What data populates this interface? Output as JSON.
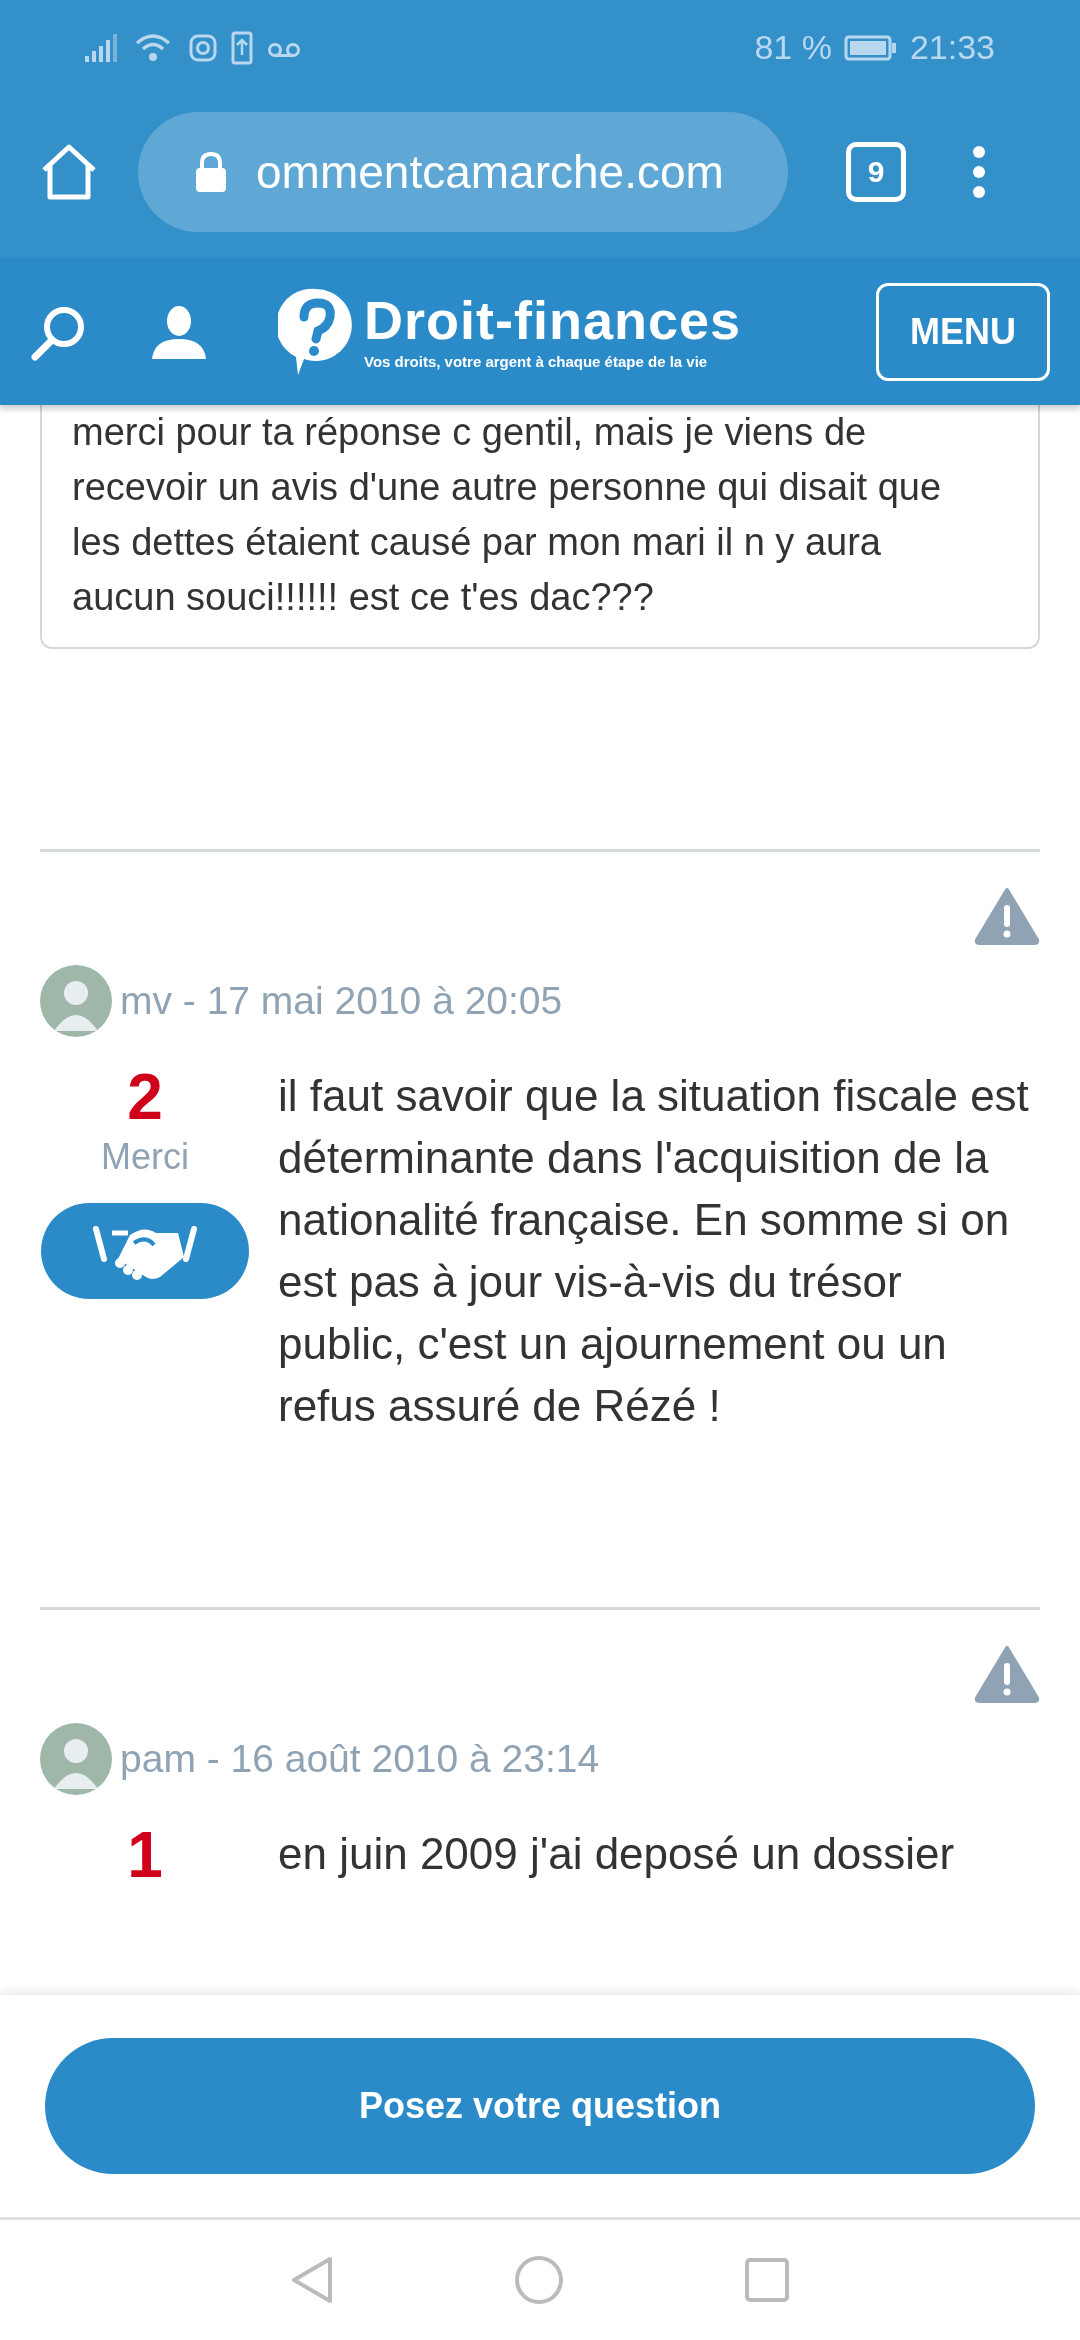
{
  "status_bar": {
    "battery_percent": "81 %",
    "time": "21:33"
  },
  "browser": {
    "url": "ommentcamarche.com",
    "tab_count": "9"
  },
  "site_header": {
    "logo_title": "Droit-finances",
    "logo_tagline": "Vos droits, votre argent à chaque étape de la vie",
    "menu_button": "MENU"
  },
  "quoted_reply": {
    "text": "merci pour ta réponse c gentil, mais je viens de recevoir un avis d'une autre personne qui disait que les dettes étaient causé par mon mari il n y aura aucun souci!!!!!! est ce t'es dac???"
  },
  "posts": [
    {
      "byline": "mv - 17 mai 2010 à 20:05",
      "thanks_count": "2",
      "thanks_label": "Merci",
      "body": "il faut savoir que la situation fiscale est déterminante dans l'acquisition de la nationalité française. En somme si on est pas à jour vis-à-vis du trésor public, c'est un ajournement ou un refus assuré de Rézé !"
    },
    {
      "byline": "pam - 16 août 2010 à 23:14",
      "thanks_count": "1",
      "body": "en juin 2009 j'ai deposé un dossier"
    }
  ],
  "ask_button": "Posez votre question"
}
